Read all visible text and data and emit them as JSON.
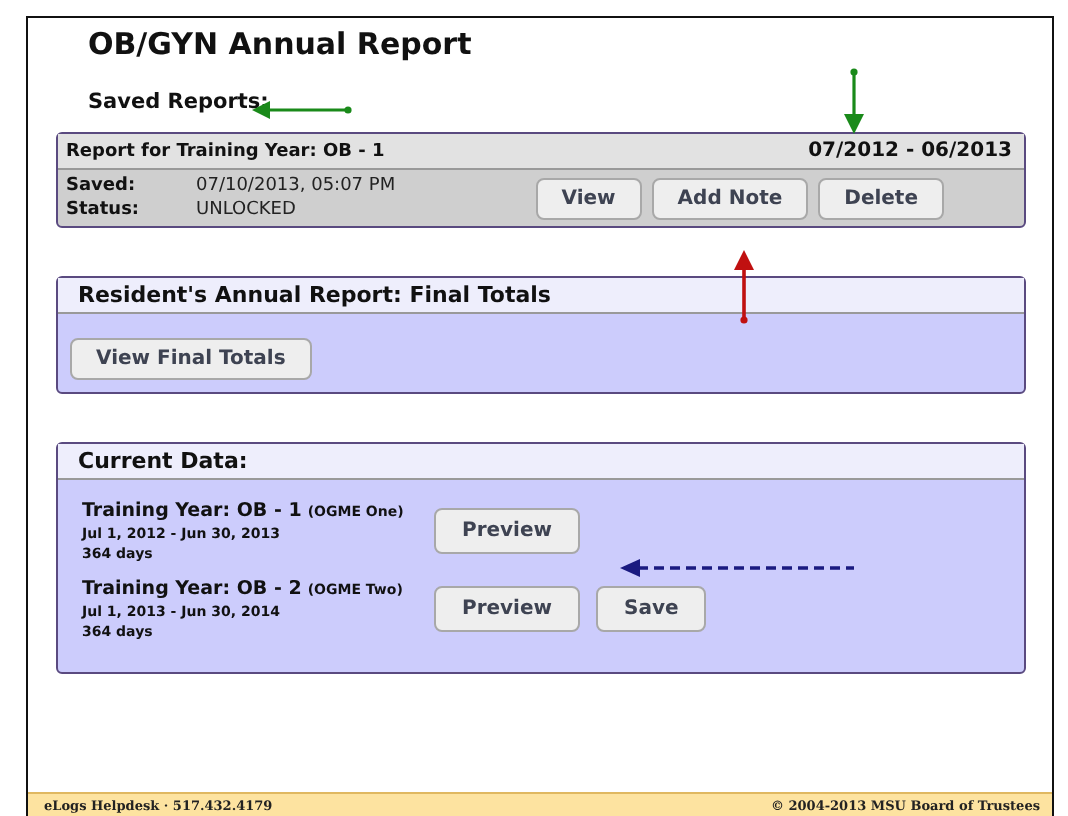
{
  "page_title": "OB/GYN Annual Report",
  "saved_reports": {
    "heading": "Saved Reports:",
    "reports": [
      {
        "title": "Report for Training Year: OB - 1",
        "period": "07/2012 - 06/2013",
        "fields": [
          {
            "label": "Saved:",
            "value": "07/10/2013, 05:07 PM"
          },
          {
            "label": "Status:",
            "value": "UNLOCKED"
          }
        ],
        "buttons": [
          "View",
          "Add Note",
          "Delete"
        ]
      }
    ]
  },
  "final_totals": {
    "heading": "Resident's Annual Report: Final Totals",
    "button": "View Final Totals"
  },
  "current_data": {
    "heading": "Current Data:",
    "years": [
      {
        "title": "Training Year: OB - 1",
        "program": "(OGME One)",
        "dates": "Jul 1, 2012 - Jun 30, 2013",
        "days": "364 days",
        "buttons": [
          "Preview"
        ]
      },
      {
        "title": "Training Year: OB - 2",
        "program": "(OGME Two)",
        "dates": "Jul 1, 2013 - Jun 30, 2014",
        "days": "364 days",
        "buttons": [
          "Preview",
          "Save"
        ]
      }
    ]
  },
  "footer": {
    "left": "eLogs Helpdesk · 517.432.4179",
    "right": "© 2004-2013 MSU Board of Trustees"
  }
}
